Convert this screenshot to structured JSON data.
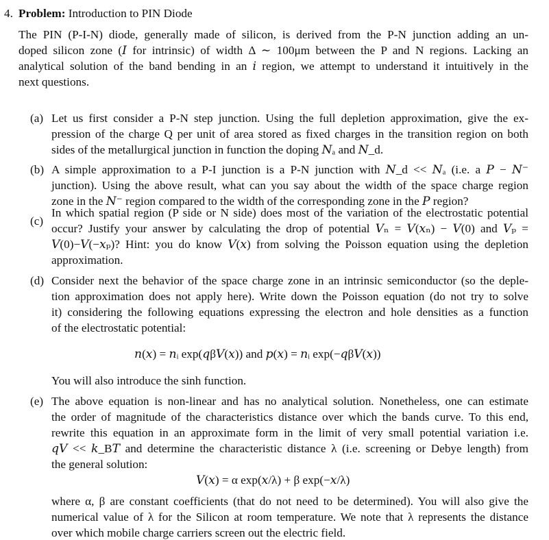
{
  "problem": {
    "number": "4.",
    "title_bold": "Problem:",
    "title_rest": "Introduction to PIN Diode"
  },
  "intro": {
    "lines": [
      "The PIN (P-I-N) diode, generally made of silicon, is derived from the P-N junction adding an un-",
      "doped silicon zone (𝐼 for intrinsic) of width Δ ∼ 100μm between the P and N regions. Lacking an",
      "analytical solution of the band bending in an 𝑖 region, we attempt to understand it intuitively in the",
      "next questions."
    ]
  },
  "questions": [
    {
      "label": "(a)",
      "lines": [
        "Let us first consider a P-N step junction. Using the full depletion approximation, give the ex-",
        "pression of the charge Q per unit of area stored as fixed charges in the transition region on both",
        "sides of the metallurgical junction in function the doping 𝑁ₐ and 𝑁_d."
      ]
    },
    {
      "label": "(b)",
      "lines": [
        "A simple approximation to a P-I junction is a P-N junction with 𝑁_d << 𝑁ₐ (i.e. a 𝑃 − 𝑁⁻",
        "junction). Using the above result, what can you say about the width of the space charge region",
        "zone in the 𝑁⁻ region compared to the width of the corresponding zone in the 𝑃 region?"
      ]
    },
    {
      "label": "(c)",
      "lines": [
        "In which spatial region (P side or N side) does most of the variation of the electrostatic potential",
        "occur? Justify your answer by calculating the drop of potential 𝑉ₙ = 𝑉(𝑥ₙ) − 𝑉(0) and 𝑉ₚ =",
        "𝑉(0)−𝑉(−𝑥ₚ)? Hint: you do know 𝑉(𝑥) from solving the Poisson equation using the depletion",
        "approximation."
      ]
    },
    {
      "label": "(d)",
      "lines": [
        "Consider next the behavior of the space charge zone in an intrinsic semiconductor (so the deple-",
        "tion approximation does not apply here). Write down the Poisson equation (do not try to solve",
        "it) considering the following equations expressing the electron and hole densities as a function",
        "of the electrostatic potential:"
      ],
      "equation": "𝑛(𝑥) = 𝑛ᵢ exp(𝑞β𝑉(𝑥))   and   𝑝(𝑥) = 𝑛ᵢ exp(−𝑞β𝑉(𝑥))",
      "after": "You will also introduce the sinh function."
    },
    {
      "label": "(e)",
      "lines": [
        "The above equation is non-linear and has no analytical solution. Nonetheless, one can estimate",
        "the order of magnitude of the characteristics distance over which the bands curve. To this end,",
        "rewrite this equation in an approximate form in the limit of very small potential variation i.e.",
        "𝑞𝑉 << 𝑘_B𝑇 and determine the characteristic distance λ (i.e. screening or Debye length) from",
        "the general solution:"
      ],
      "equation": "𝑉(𝑥) = α exp(𝑥/λ) + β exp(−𝑥/λ)",
      "after_lines": [
        "where α, β are constant coefficients (that do not need to be determined). You will also give the",
        "numerical value of λ for the Silicon at room temperature. We note that λ represents the distance",
        "over which mobile charge carriers screen out the electric field."
      ]
    }
  ]
}
